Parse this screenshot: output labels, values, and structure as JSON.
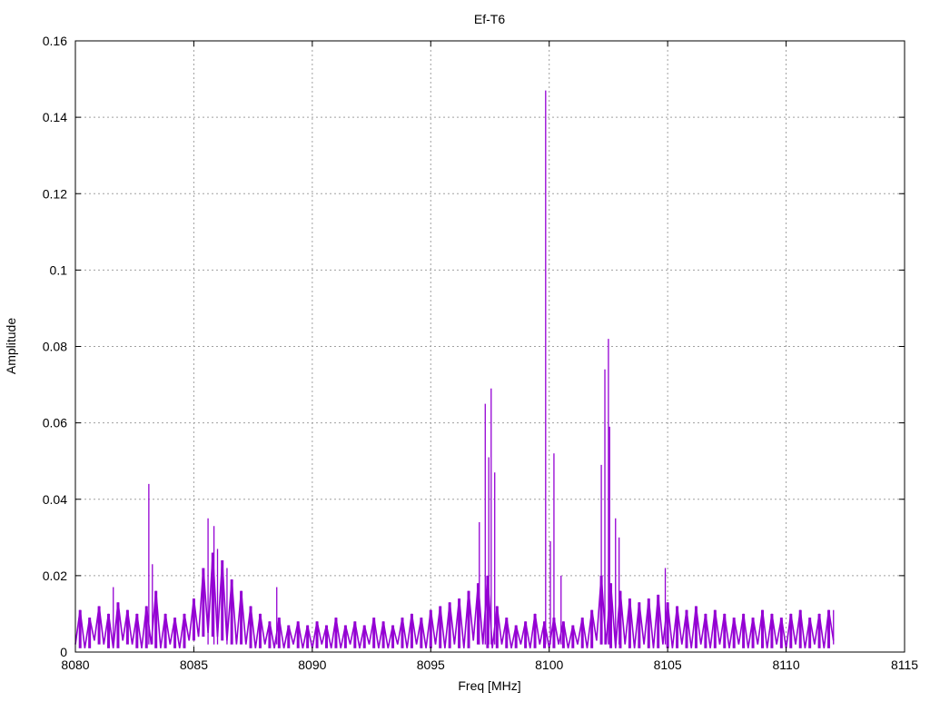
{
  "chart_data": {
    "type": "line",
    "title": "Ef-T6",
    "xlabel": "Freq [MHz]",
    "ylabel": "Amplitude",
    "xlim": [
      8080,
      8115
    ],
    "ylim": [
      0,
      0.16
    ],
    "grid": true,
    "xticks": [
      "8080",
      "8085",
      "8090",
      "8095",
      "8100",
      "8105",
      "8110",
      "8115"
    ],
    "xtick_values": [
      8080,
      8085,
      8090,
      8095,
      8100,
      8105,
      8110,
      8115
    ],
    "yticks": [
      "0",
      "0.02",
      "0.04",
      "0.06",
      "0.08",
      "0.1",
      "0.12",
      "0.14",
      "0.16"
    ],
    "ytick_values": [
      0,
      0.02,
      0.04,
      0.06,
      0.08,
      0.1,
      0.12,
      0.14,
      0.16
    ],
    "series": [
      {
        "name": "Ef-T6",
        "color": "#9400d3",
        "x_start": 8080,
        "x_step": 0.2,
        "values": [
          0.002,
          0.011,
          0.001,
          0.009,
          0.003,
          0.012,
          0.002,
          0.01,
          0.001,
          0.013,
          0.003,
          0.011,
          0.002,
          0.01,
          0.001,
          0.012,
          0.002,
          0.016,
          0.001,
          0.01,
          0.002,
          0.009,
          0.001,
          0.01,
          0.003,
          0.014,
          0.004,
          0.022,
          0.005,
          0.026,
          0.004,
          0.024,
          0.003,
          0.019,
          0.002,
          0.016,
          0.002,
          0.012,
          0.001,
          0.01,
          0.002,
          0.008,
          0.001,
          0.009,
          0.001,
          0.007,
          0.002,
          0.008,
          0.001,
          0.007,
          0.001,
          0.008,
          0.002,
          0.007,
          0.001,
          0.009,
          0.001,
          0.007,
          0.002,
          0.008,
          0.001,
          0.007,
          0.002,
          0.009,
          0.001,
          0.008,
          0.001,
          0.007,
          0.002,
          0.009,
          0.001,
          0.01,
          0.002,
          0.009,
          0.001,
          0.011,
          0.002,
          0.012,
          0.001,
          0.013,
          0.002,
          0.014,
          0.001,
          0.016,
          0.003,
          0.018,
          0.002,
          0.02,
          0.001,
          0.012,
          0.002,
          0.009,
          0.001,
          0.007,
          0.002,
          0.008,
          0.001,
          0.01,
          0.002,
          0.008,
          0.001,
          0.009,
          0.002,
          0.008,
          0.001,
          0.007,
          0.002,
          0.009,
          0.001,
          0.011,
          0.003,
          0.02,
          0.002,
          0.018,
          0.001,
          0.016,
          0.002,
          0.014,
          0.001,
          0.013,
          0.002,
          0.014,
          0.001,
          0.015,
          0.002,
          0.013,
          0.001,
          0.012,
          0.002,
          0.011,
          0.001,
          0.012,
          0.002,
          0.01,
          0.001,
          0.011,
          0.002,
          0.01,
          0.001,
          0.009,
          0.002,
          0.01,
          0.001,
          0.009,
          0.002,
          0.011,
          0.001,
          0.01,
          0.002,
          0.009,
          0.001,
          0.01,
          0.002,
          0.011,
          0.001,
          0.009,
          0.002,
          0.01,
          0.001,
          0.011,
          0.003
        ],
        "peaks": [
          [
            8081.6,
            0.017
          ],
          [
            8083.1,
            0.044
          ],
          [
            8083.25,
            0.023
          ],
          [
            8085.6,
            0.035
          ],
          [
            8085.85,
            0.033
          ],
          [
            8086.0,
            0.027
          ],
          [
            8086.4,
            0.022
          ],
          [
            8088.5,
            0.017
          ],
          [
            8097.05,
            0.034
          ],
          [
            8097.3,
            0.065
          ],
          [
            8097.45,
            0.051
          ],
          [
            8097.55,
            0.069
          ],
          [
            8097.7,
            0.047
          ],
          [
            8099.85,
            0.147
          ],
          [
            8100.05,
            0.029
          ],
          [
            8100.2,
            0.052
          ],
          [
            8100.5,
            0.02
          ],
          [
            8102.2,
            0.049
          ],
          [
            8102.35,
            0.074
          ],
          [
            8102.5,
            0.082
          ],
          [
            8102.55,
            0.059
          ],
          [
            8102.8,
            0.035
          ],
          [
            8102.95,
            0.03
          ],
          [
            8104.9,
            0.022
          ],
          [
            8112.0,
            0.011
          ]
        ]
      }
    ]
  }
}
